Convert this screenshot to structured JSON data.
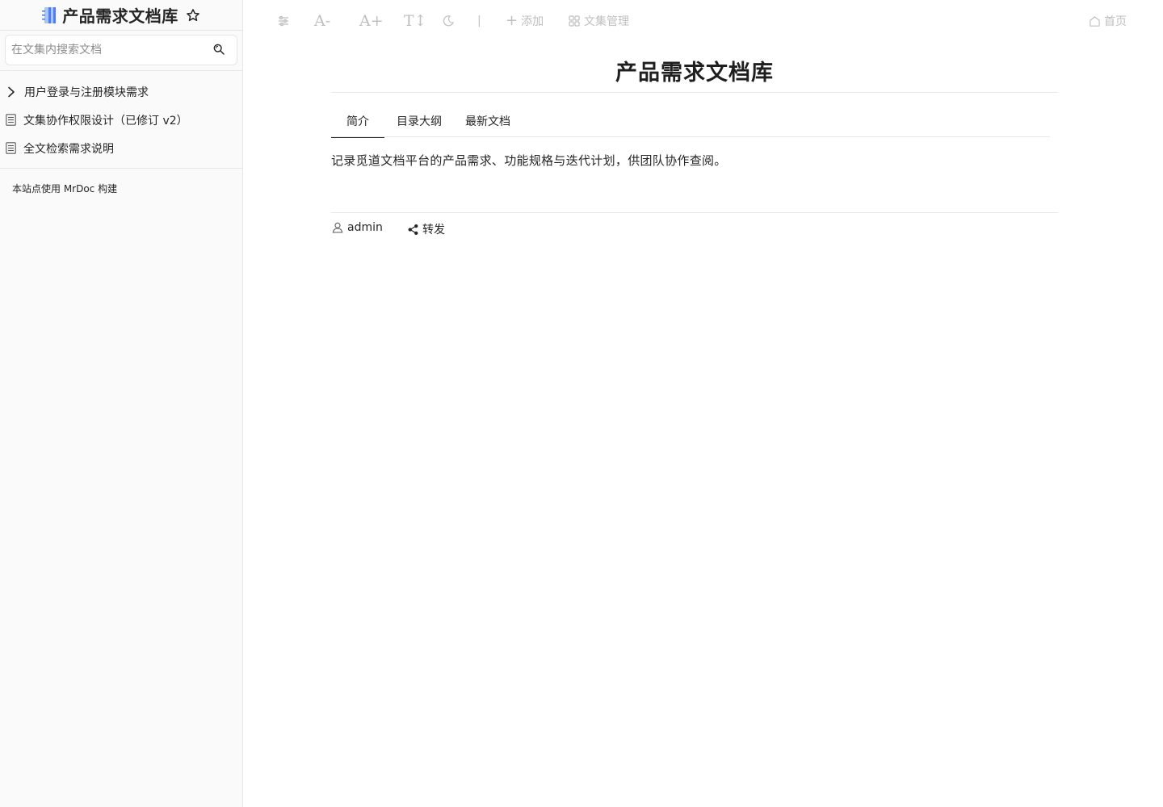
{
  "sidebar": {
    "title": "产品需求文档库",
    "search_placeholder": "在文集内搜索文档",
    "items": [
      {
        "label": "用户登录与注册模块需求",
        "icon": "chevron-right-icon"
      },
      {
        "label": "文集协作权限设计（已修订 v2）",
        "icon": "document-icon"
      },
      {
        "label": "全文检索需求说明",
        "icon": "document-icon"
      }
    ],
    "footer": "本站点使用 MrDoc 构建"
  },
  "toolbar": {
    "font_decrease": "A-",
    "font_increase": "A+",
    "font_toggle": "T↕",
    "separator": "|",
    "add_label": "添加",
    "manage_label": "文集管理",
    "home_label": "首页"
  },
  "main": {
    "title": "产品需求文档库",
    "tabs": [
      {
        "label": "简介",
        "active": true
      },
      {
        "label": "目录大纲",
        "active": false
      },
      {
        "label": "最新文档",
        "active": false
      }
    ],
    "description": "记录觅道文档平台的产品需求、功能规格与迭代计划，供团队协作查阅。",
    "author": "admin",
    "share_label": "转发"
  },
  "colors": {
    "sidebar_bg": "#fafafa",
    "border": "#e6e6e6",
    "toolbar_icon": "#bfbfbf",
    "text": "#262626",
    "book_icon_blue": "#5b8ff9"
  }
}
